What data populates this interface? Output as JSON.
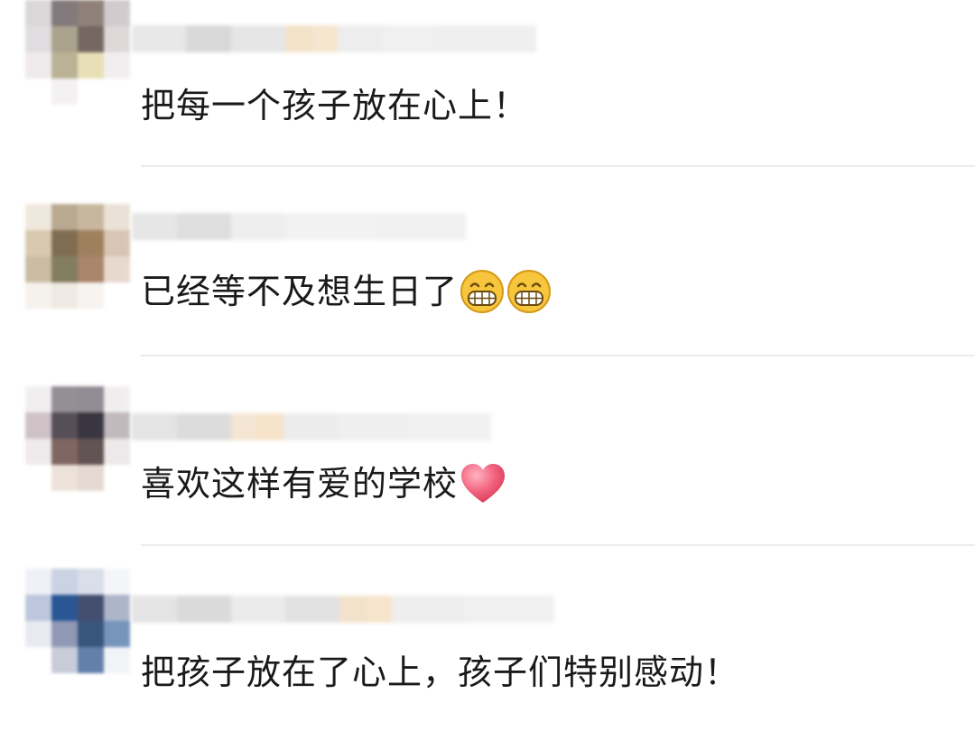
{
  "comments": [
    {
      "author_redacted": true,
      "text": "把每一个孩子放在心上！",
      "emojis": []
    },
    {
      "author_redacted": true,
      "text": "已经等不及想生日了",
      "emojis": [
        "grin-emoji",
        "grin-emoji"
      ]
    },
    {
      "author_redacted": true,
      "text": "喜欢这样有爱的学校",
      "emojis": [
        "heart-emoji"
      ]
    },
    {
      "author_redacted": true,
      "text": "把孩子放在了心上，孩子们特别感动！",
      "emojis": []
    }
  ],
  "colors": {
    "text": "#1a1a1a",
    "divider": "#ececec",
    "emoji_face": "#f7c63d",
    "heart": "#f2637f"
  }
}
